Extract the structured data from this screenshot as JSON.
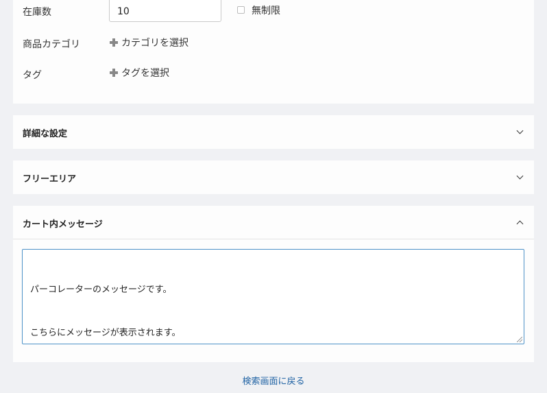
{
  "basic": {
    "stock": {
      "label": "在庫数",
      "value": "10",
      "unlimited_label": "無制限",
      "unlimited_checked": false
    },
    "category": {
      "label": "商品カテゴリ",
      "add_label": "カテゴリを選択",
      "icon": "plus-icon"
    },
    "tag": {
      "label": "タグ",
      "add_label": "タグを選択",
      "icon": "plus-icon"
    }
  },
  "sections": {
    "detail": {
      "title": "詳細な設定",
      "expanded": false,
      "icon": "chevron-down-icon"
    },
    "free_area": {
      "title": "フリーエリア",
      "expanded": false,
      "icon": "chevron-down-icon"
    },
    "cart_message": {
      "title": "カート内メッセージ",
      "expanded": true,
      "icon": "chevron-up-icon",
      "lines": [
        "パーコレーターのメッセージです。",
        "こちらにメッセージが表示されます。"
      ]
    }
  },
  "footer": {
    "back_label": "検索画面に戻る",
    "link_color": "#1f62a3"
  },
  "colors": {
    "background": "#f0f1f4",
    "card": "#fdfdfd",
    "focus_border": "#4a90c7"
  }
}
